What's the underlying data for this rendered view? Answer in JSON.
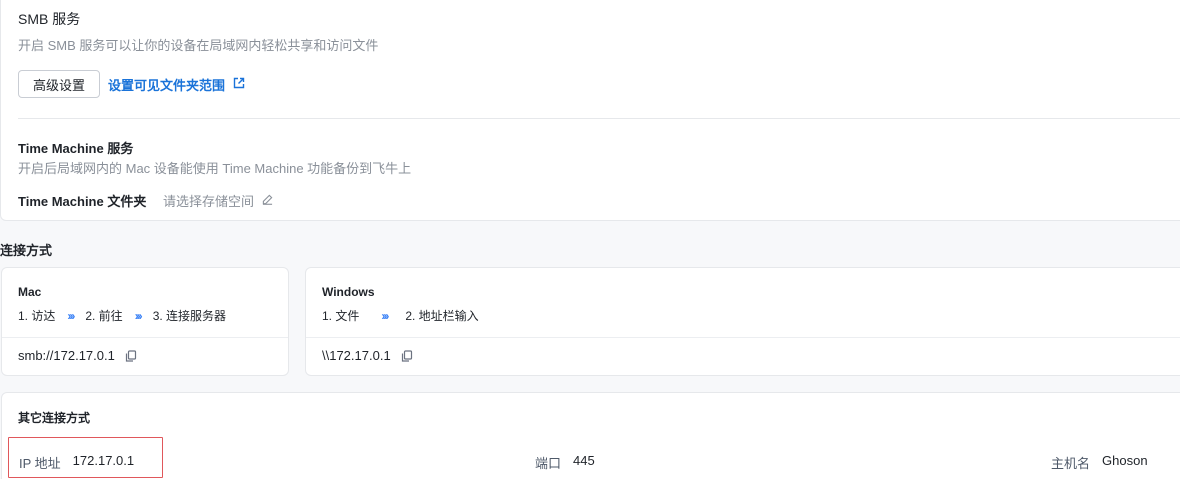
{
  "smb": {
    "title": "SMB 服务",
    "description": "开启 SMB 服务可以让你的设备在局域网内轻松共享和访问文件",
    "advanced_button": "高级设置",
    "folder_scope_link": "设置可见文件夹范围"
  },
  "time_machine": {
    "title": "Time Machine 服务",
    "description": "开启后局域网内的 Mac 设备能使用 Time Machine 功能备份到飞牛上",
    "folder_label": "Time Machine 文件夹",
    "folder_value": "请选择存储空间"
  },
  "connection": {
    "section_title": "连接方式",
    "mac": {
      "name": "Mac",
      "steps": [
        "1. 访达",
        "2. 前往",
        "3. 连接服务器"
      ],
      "address": "smb://172.17.0.1"
    },
    "windows": {
      "name": "Windows",
      "steps": [
        "1. 文件",
        "2. 地址栏输入"
      ],
      "address": "\\\\172.17.0.1"
    },
    "chevron": "›››"
  },
  "other": {
    "title": "其它连接方式",
    "ip_label": "IP 地址",
    "ip_value": "172.17.0.1",
    "port_label": "端口",
    "port_value": "445",
    "host_label": "主机名",
    "host_value": "Ghoson"
  },
  "colors": {
    "link": "#1a73d9",
    "chevron": "#3b82f6",
    "highlight": "#e0575b",
    "muted_text": "#8a9099"
  },
  "icons": {
    "external_link": "external-link-icon",
    "edit": "pencil-icon",
    "copy": "copy-icon"
  }
}
